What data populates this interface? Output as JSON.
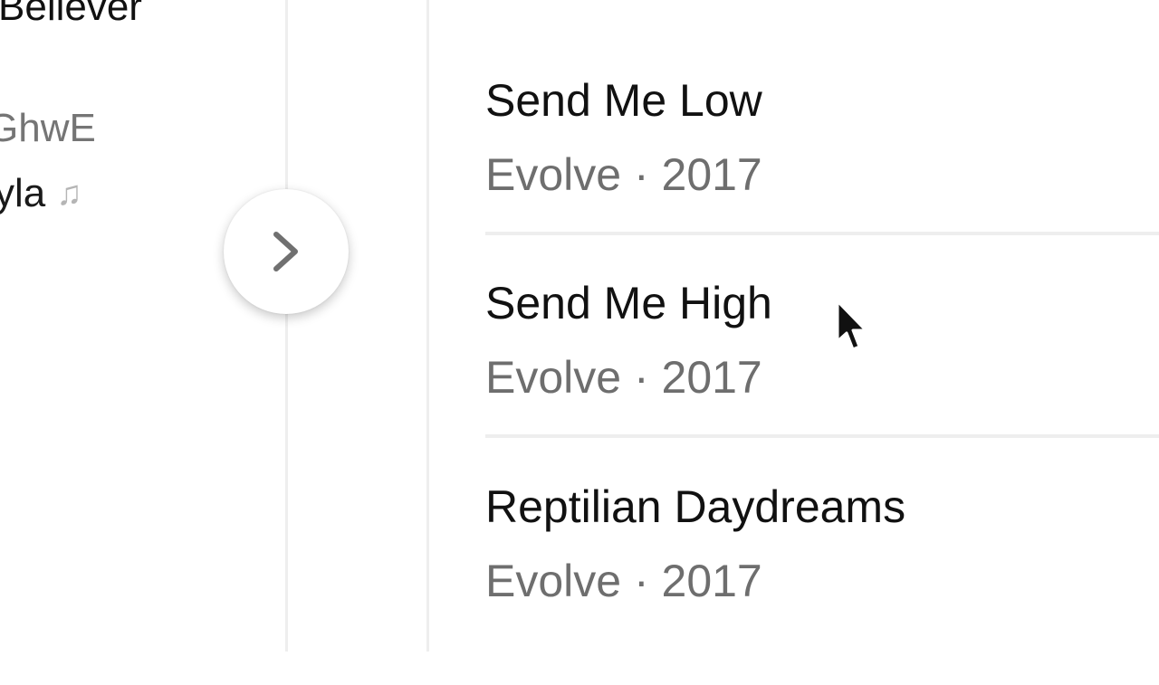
{
  "left_panel": {
    "title": "Believer",
    "code": "GhwE",
    "name": "yla",
    "name_icon": "music-note-icon"
  },
  "expand_button": {
    "icon": "chevron-right-icon"
  },
  "tracks": [
    {
      "title": "Send Me Low",
      "meta": "Evolve · 2017"
    },
    {
      "title": "Send Me High",
      "meta": "Evolve · 2017"
    },
    {
      "title": "Reptilian Daydreams",
      "meta": "Evolve · 2017"
    }
  ],
  "colors": {
    "title_text": "#111111",
    "meta_text": "#6e6e6e",
    "divider": "#eeeeee",
    "background": "#ffffff"
  }
}
